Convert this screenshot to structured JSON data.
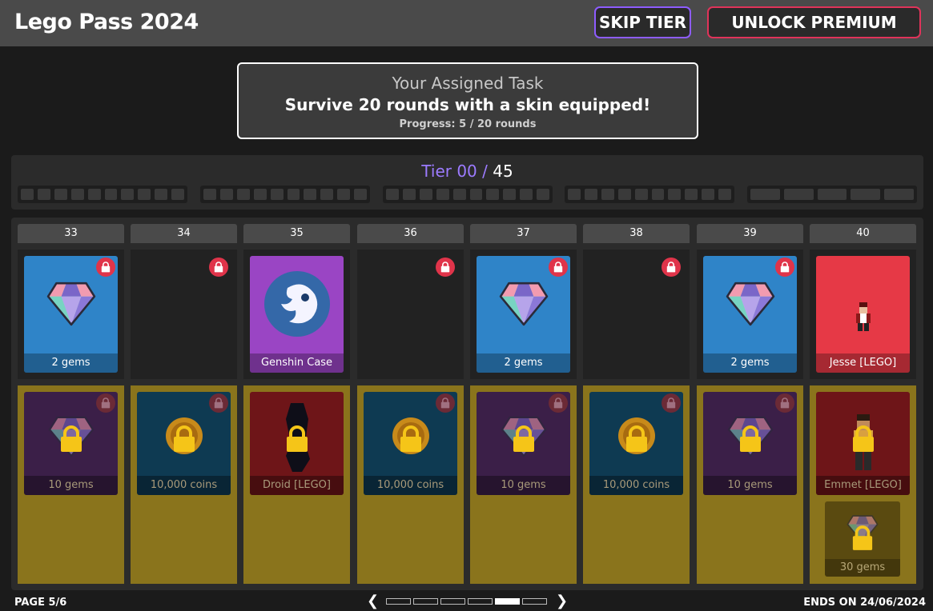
{
  "header": {
    "title": "Lego Pass 2024",
    "skip_label": "SKIP TIER",
    "premium_label": "UNLOCK PREMIUM"
  },
  "task": {
    "heading": "Your Assigned Task",
    "description": "Survive 20 rounds with a skin equipped!",
    "progress": "Progress: 5 / 20 rounds"
  },
  "tier": {
    "current": "Tier 00",
    "separator": "/",
    "total": "45"
  },
  "columns": [
    {
      "tier": "33",
      "free": {
        "type": "gem",
        "label": "2 gems",
        "color": "#2f84c8"
      },
      "premium": {
        "type": "gem",
        "label": "10 gems",
        "color": "#3b1f48"
      }
    },
    {
      "tier": "34",
      "free": {
        "type": "empty",
        "label": ""
      },
      "premium": {
        "type": "coin",
        "label": "10,000 coins",
        "color": "#0e3a52"
      }
    },
    {
      "tier": "35",
      "free": {
        "type": "case",
        "label": "Genshin Case",
        "color": "#9a45c4"
      },
      "premium": {
        "type": "skin",
        "label": "Droid [LEGO]",
        "color": "#6e1518"
      }
    },
    {
      "tier": "36",
      "free": {
        "type": "empty",
        "label": ""
      },
      "premium": {
        "type": "coin",
        "label": "10,000 coins",
        "color": "#0e3a52"
      }
    },
    {
      "tier": "37",
      "free": {
        "type": "gem",
        "label": "2 gems",
        "color": "#2f84c8"
      },
      "premium": {
        "type": "gem",
        "label": "10 gems",
        "color": "#3b1f48"
      }
    },
    {
      "tier": "38",
      "free": {
        "type": "empty",
        "label": ""
      },
      "premium": {
        "type": "coin",
        "label": "10,000 coins",
        "color": "#0e3a52"
      }
    },
    {
      "tier": "39",
      "free": {
        "type": "gem",
        "label": "2 gems",
        "color": "#2f84c8"
      },
      "premium": {
        "type": "gem",
        "label": "10 gems",
        "color": "#3b1f48"
      }
    },
    {
      "tier": "40",
      "free": {
        "type": "skin",
        "label": "Jesse [LEGO]",
        "color": "#e63946"
      },
      "premium": {
        "type": "skin",
        "label": "Emmet [LEGO]",
        "color": "#6e1518"
      },
      "bonus": {
        "type": "gem",
        "label": "30 gems"
      }
    }
  ],
  "footer": {
    "page": "PAGE 5/6",
    "ends": "ENDS ON 24/06/2024",
    "pages_total": 6,
    "page_active": 5
  },
  "colors": {
    "accent_purple": "#8e5cff",
    "accent_red": "#e0335a",
    "premium_track": "#8a741c",
    "lock_red": "#e0344a",
    "lock_yellow": "#f5c518"
  }
}
